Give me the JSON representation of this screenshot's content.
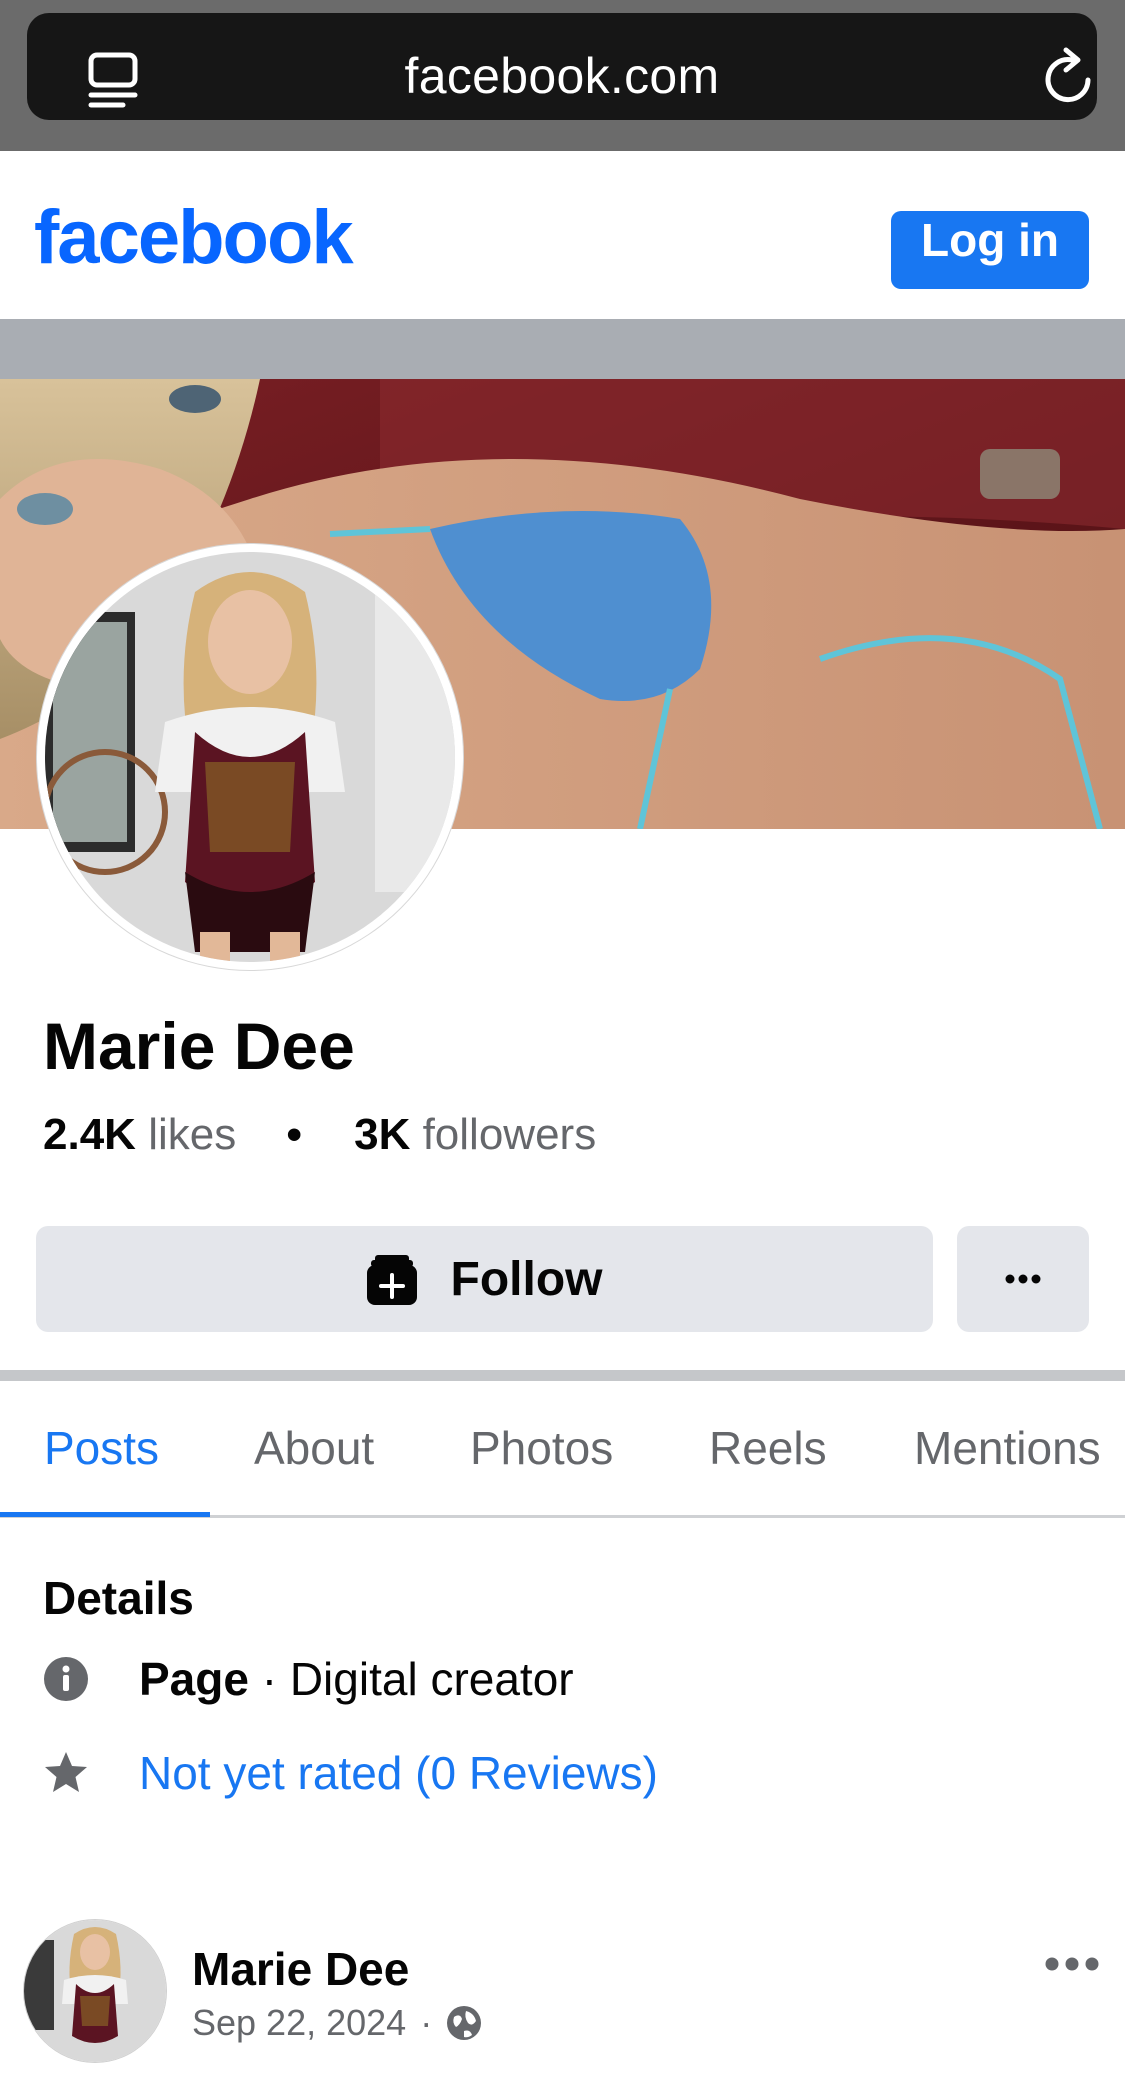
{
  "browser": {
    "url": "facebook.com"
  },
  "header": {
    "logo": "facebook",
    "login_label": "Log in"
  },
  "profile": {
    "name": "Marie Dee",
    "likes_count": "2.4K",
    "likes_label": "likes",
    "separator": "•",
    "followers_count": "3K",
    "followers_label": "followers"
  },
  "actions": {
    "follow_label": "Follow",
    "more_label": "···"
  },
  "tabs": [
    {
      "label": "Posts",
      "active": true
    },
    {
      "label": "About",
      "active": false
    },
    {
      "label": "Photos",
      "active": false
    },
    {
      "label": "Reels",
      "active": false
    },
    {
      "label": "Mentions",
      "active": false
    }
  ],
  "details": {
    "title": "Details",
    "page_label": "Page",
    "category": " · Digital creator",
    "rating": "Not yet rated (0 Reviews)"
  },
  "post": {
    "author": "Marie Dee",
    "date": "Sep 22, 2024",
    "separator": "·"
  },
  "colors": {
    "brand_blue": "#0866ff",
    "button_blue": "#1877f2",
    "secondary_text": "#65676b",
    "button_gray": "#e4e6eb"
  }
}
